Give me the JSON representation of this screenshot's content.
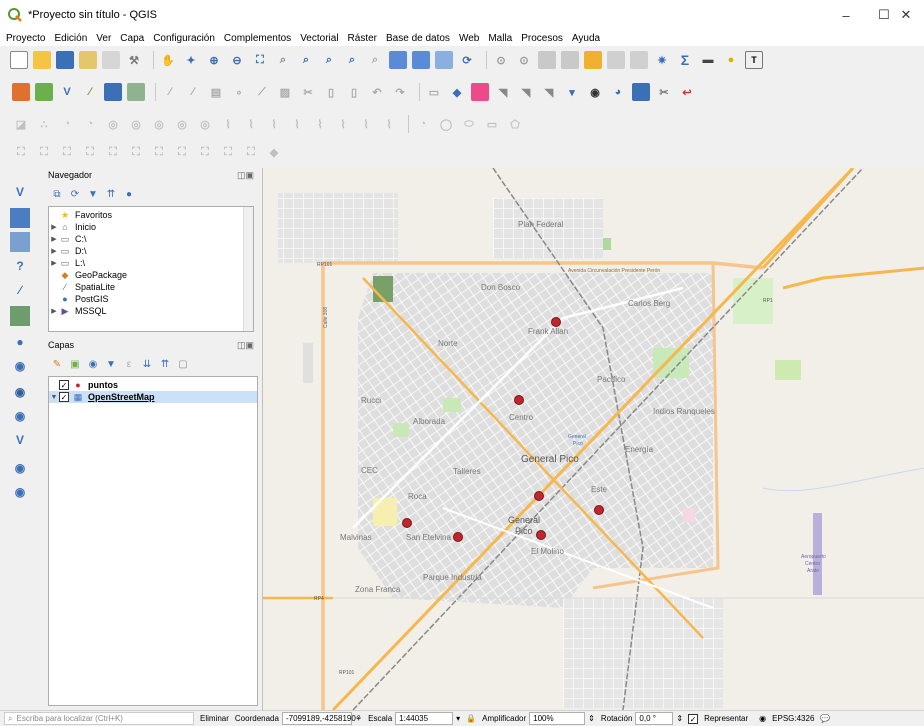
{
  "window": {
    "title": "*Proyecto sin título - QGIS",
    "minimize": "–",
    "maximize": "☐",
    "close": "✕"
  },
  "menu": [
    "Proyecto",
    "Edición",
    "Ver",
    "Capa",
    "Configuración",
    "Complementos",
    "Vectorial",
    "Ráster",
    "Base de datos",
    "Web",
    "Malla",
    "Procesos",
    "Ayuda"
  ],
  "browser": {
    "title": "Navegador",
    "items": [
      {
        "label": "Favoritos",
        "icon": "star-icon"
      },
      {
        "label": "Inicio",
        "icon": "home-folder-icon"
      },
      {
        "label": "C:\\",
        "icon": "drive-icon"
      },
      {
        "label": "D:\\",
        "icon": "drive-icon"
      },
      {
        "label": "L:\\",
        "icon": "drive-icon"
      },
      {
        "label": "GeoPackage",
        "icon": "geopackage-icon"
      },
      {
        "label": "SpatiaLite",
        "icon": "spatialite-icon"
      },
      {
        "label": "PostGIS",
        "icon": "postgis-icon"
      },
      {
        "label": "MSSQL",
        "icon": "mssql-icon"
      }
    ]
  },
  "layers": {
    "title": "Capas",
    "items": [
      {
        "label": "puntos",
        "checked": "✓"
      },
      {
        "label": "OpenStreetMap",
        "checked": "✓"
      }
    ]
  },
  "map_labels": {
    "federal": "Plan Federal",
    "donbosco": "Don Bosco",
    "carlosberg": "Carlos Berg",
    "frankallan": "Frank Allan",
    "norte": "Norte",
    "pacifico": "Pacífico",
    "rucci": "Rucci",
    "alborada": "Alborada",
    "centro": "Centro",
    "indios": "Indios Ranqueles",
    "energia": "Energía",
    "generalpico": "General Pico",
    "cec": "CEC",
    "talleres": "Talleres",
    "roca": "Roca",
    "este": "Este",
    "generalpico2a": "General",
    "generalpico2b": "Pico",
    "malvinas": "Malvinas",
    "sanetelvina": "San Etelvina",
    "elmolino": "El Molino",
    "parquesindustria": "Parque Industria",
    "zonafranca": "Zona Franca",
    "avenida": "Avenida Circunvalación Presidente Perón",
    "rp101a": "RP101",
    "rp101b": "RP101",
    "rp1": "RP1",
    "rp4": "RP4",
    "calle": "Calle 308",
    "aeropuerto1": "Aeropuerto",
    "aeropuerto2": "Centro",
    "aeropuerto3": "Arato",
    "generalstation1": "General",
    "generalstation2": "Pico"
  },
  "status": {
    "locate_placeholder": "Escriba para localizar (Ctrl+K)",
    "eliminar": "Eliminar",
    "coord_label": "Coordenada",
    "coord_value": "-7099189,-4258190",
    "scale_label": "Escala",
    "scale_value": "1:44035",
    "magnifier_label": "Amplificador",
    "magnifier_value": "100%",
    "rotation_label": "Rotación",
    "rotation_value": "0,0 °",
    "render_label": "Representar",
    "render_check": "✓",
    "crs": "EPSG:4326"
  }
}
